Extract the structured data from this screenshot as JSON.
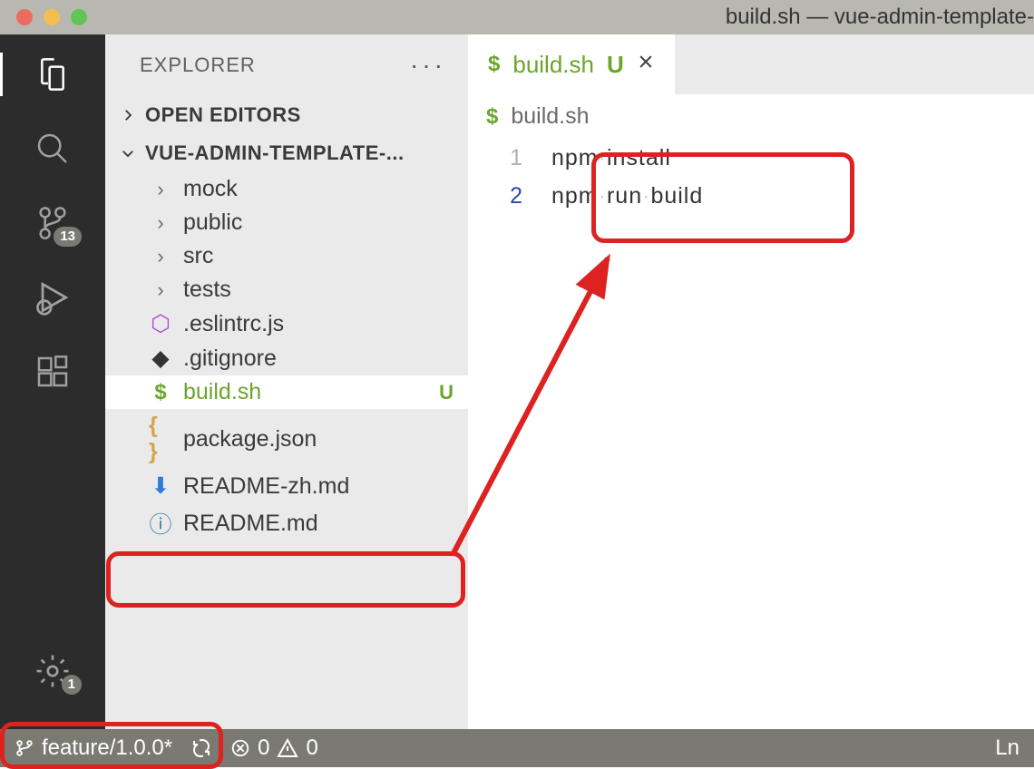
{
  "window": {
    "title": "build.sh — vue-admin-template-"
  },
  "activity": {
    "scm_badge": "13",
    "settings_badge": "1"
  },
  "sidebar": {
    "title": "EXPLORER",
    "open_editors": "OPEN EDITORS",
    "project": "VUE-ADMIN-TEMPLATE-...",
    "items": [
      {
        "name": "mock",
        "type": "folder"
      },
      {
        "name": "public",
        "type": "folder"
      },
      {
        "name": "src",
        "type": "folder"
      },
      {
        "name": "tests",
        "type": "folder"
      },
      {
        "name": ".eslintrc.js",
        "type": "file",
        "icon": "hexagon"
      },
      {
        "name": ".gitignore",
        "type": "file",
        "icon": "diamond"
      },
      {
        "name": "build.sh",
        "type": "file",
        "icon": "dollar",
        "status": "U",
        "selected": true,
        "green": true
      },
      {
        "name": "package.json",
        "type": "file",
        "icon": "braces"
      },
      {
        "name": "README-zh.md",
        "type": "file",
        "icon": "md-arrow"
      },
      {
        "name": "README.md",
        "type": "file",
        "icon": "info"
      }
    ]
  },
  "tab": {
    "name": "build.sh",
    "status": "U"
  },
  "breadcrumb": {
    "file": "build.sh"
  },
  "editor": {
    "lines": [
      {
        "num": "1",
        "text": "npm install"
      },
      {
        "num": "2",
        "text": "npm run build"
      }
    ]
  },
  "statusbar": {
    "branch": "feature/1.0.0*",
    "errors": "0",
    "warnings": "0",
    "right": "Ln"
  }
}
